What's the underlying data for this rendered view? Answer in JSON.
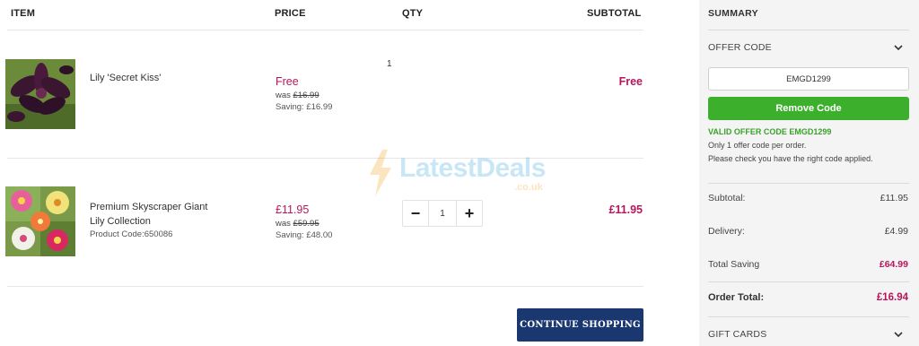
{
  "cart": {
    "headers": {
      "item": "ITEM",
      "price": "PRICE",
      "qty": "QTY",
      "subtotal": "SUBTOTAL"
    },
    "items": [
      {
        "name": "Lily 'Secret Kiss'",
        "product_code": "",
        "price": "Free",
        "was_label": "was",
        "was_price": "£16.99",
        "saving": "Saving: £16.99",
        "qty": "1",
        "subtotal": "Free",
        "image_icon": "lily-dark-purple-image"
      },
      {
        "name_line1": "Premium Skyscraper Giant",
        "name_line2": "Lily Collection",
        "product_code": "Product Code:650086",
        "price": "£11.95",
        "was_label": "was",
        "was_price": "£59.95",
        "saving": "Saving: £48.00",
        "qty": "1",
        "subtotal": "£11.95",
        "image_icon": "lily-collection-image"
      }
    ],
    "stepper": {
      "minus": "−",
      "plus": "+"
    },
    "continue_label": "CONTINUE SHOPPING",
    "watermark": {
      "text": "LatestDeals",
      "sub": ".co.uk"
    }
  },
  "summary": {
    "title": "SUMMARY",
    "offer_code_label": "OFFER CODE",
    "offer_code_value": "EMGD1299",
    "remove_label": "Remove Code",
    "valid_msg": "VALID OFFER CODE EMGD1299",
    "note1": "Only 1 offer code per order.",
    "note2": "Please check you have the right code applied.",
    "subtotal_label": "Subtotal:",
    "subtotal_value": "£11.95",
    "delivery_label": "Delivery:",
    "delivery_value": "£4.99",
    "saving_label": "Total Saving",
    "saving_value": "£64.99",
    "total_label": "Order Total:",
    "total_value": "£16.94",
    "gift_cards_label": "GIFT CARDS"
  },
  "colors": {
    "accent_price": "#b5165d",
    "button_navy": "#1b3770",
    "button_green": "#3cb02d",
    "valid_green": "#3aa02b"
  }
}
